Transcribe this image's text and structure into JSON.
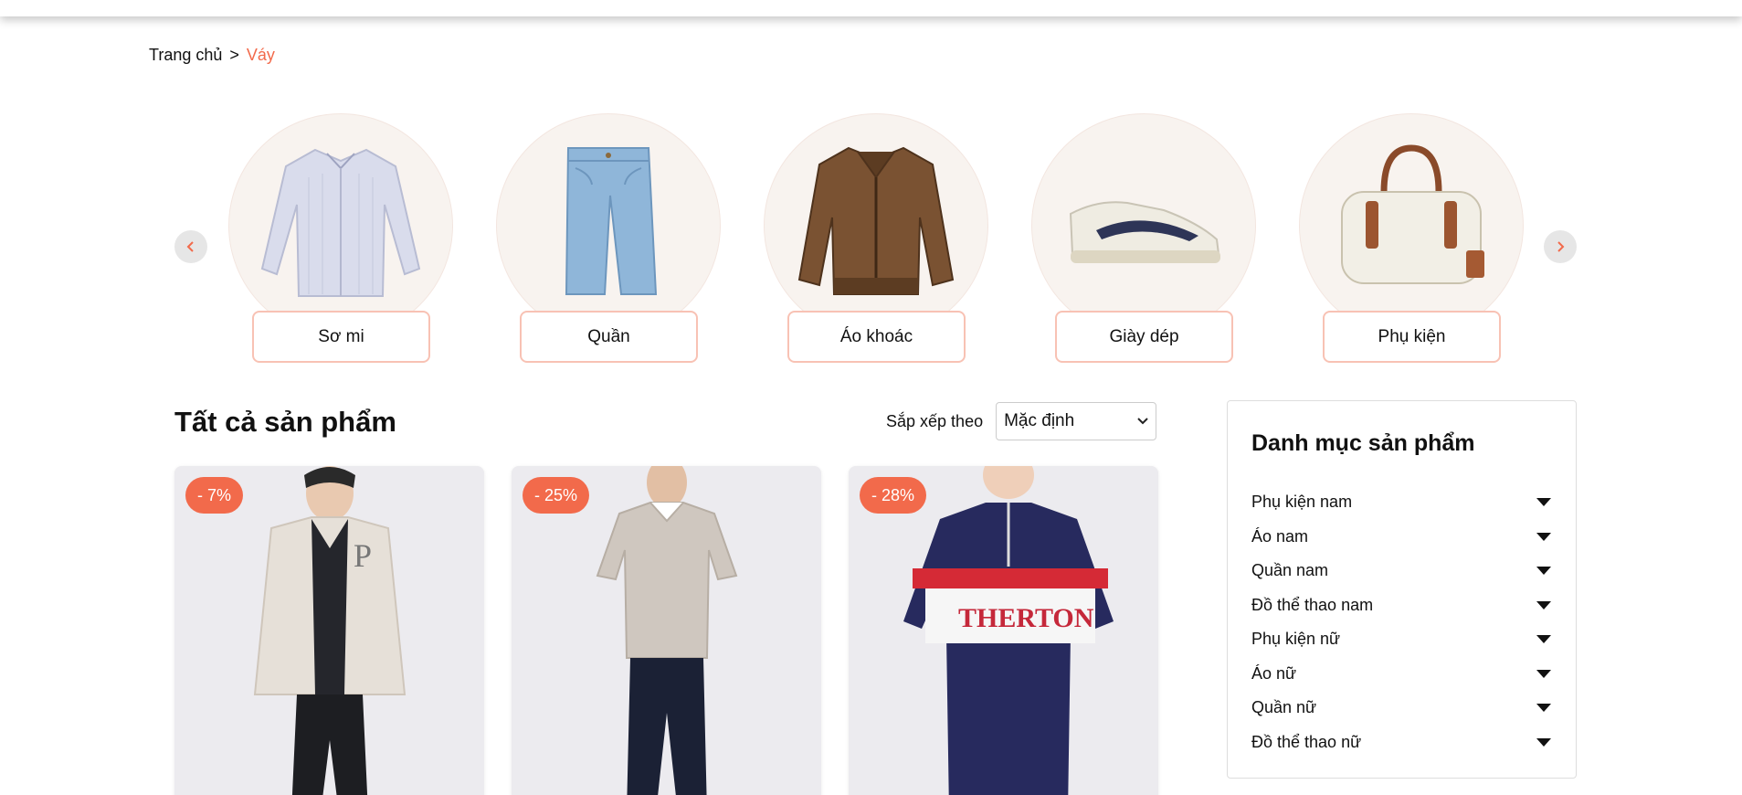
{
  "breadcrumb": {
    "home": "Trang chủ",
    "separator": ">",
    "current": "Váy"
  },
  "categories": [
    {
      "label": "Sơ mi",
      "icon": "shirt-image"
    },
    {
      "label": "Quần",
      "icon": "jeans-image"
    },
    {
      "label": "Áo khoác",
      "icon": "jacket-image"
    },
    {
      "label": "Giày dép",
      "icon": "sneaker-image"
    },
    {
      "label": "Phụ kiện",
      "icon": "handbag-image"
    }
  ],
  "products_section": {
    "title": "Tất cả sản phẩm",
    "sort_label": "Sắp xếp theo",
    "sort_value": "Mặc định"
  },
  "products": [
    {
      "discount": "- 7%"
    },
    {
      "discount": "- 25%"
    },
    {
      "discount": "- 28%"
    }
  ],
  "sidebar": {
    "title": "Danh mục sản phẩm",
    "items": [
      "Phụ kiện nam",
      "Áo nam",
      "Quần nam",
      "Đồ thể thao nam",
      "Phụ kiện nữ",
      "Áo nữ",
      "Quần nữ",
      "Đồ thể thao nữ"
    ]
  },
  "colors": {
    "accent": "#f26a4b",
    "label_border": "#f8c2b4",
    "circle_bg": "#f8f3ef"
  }
}
